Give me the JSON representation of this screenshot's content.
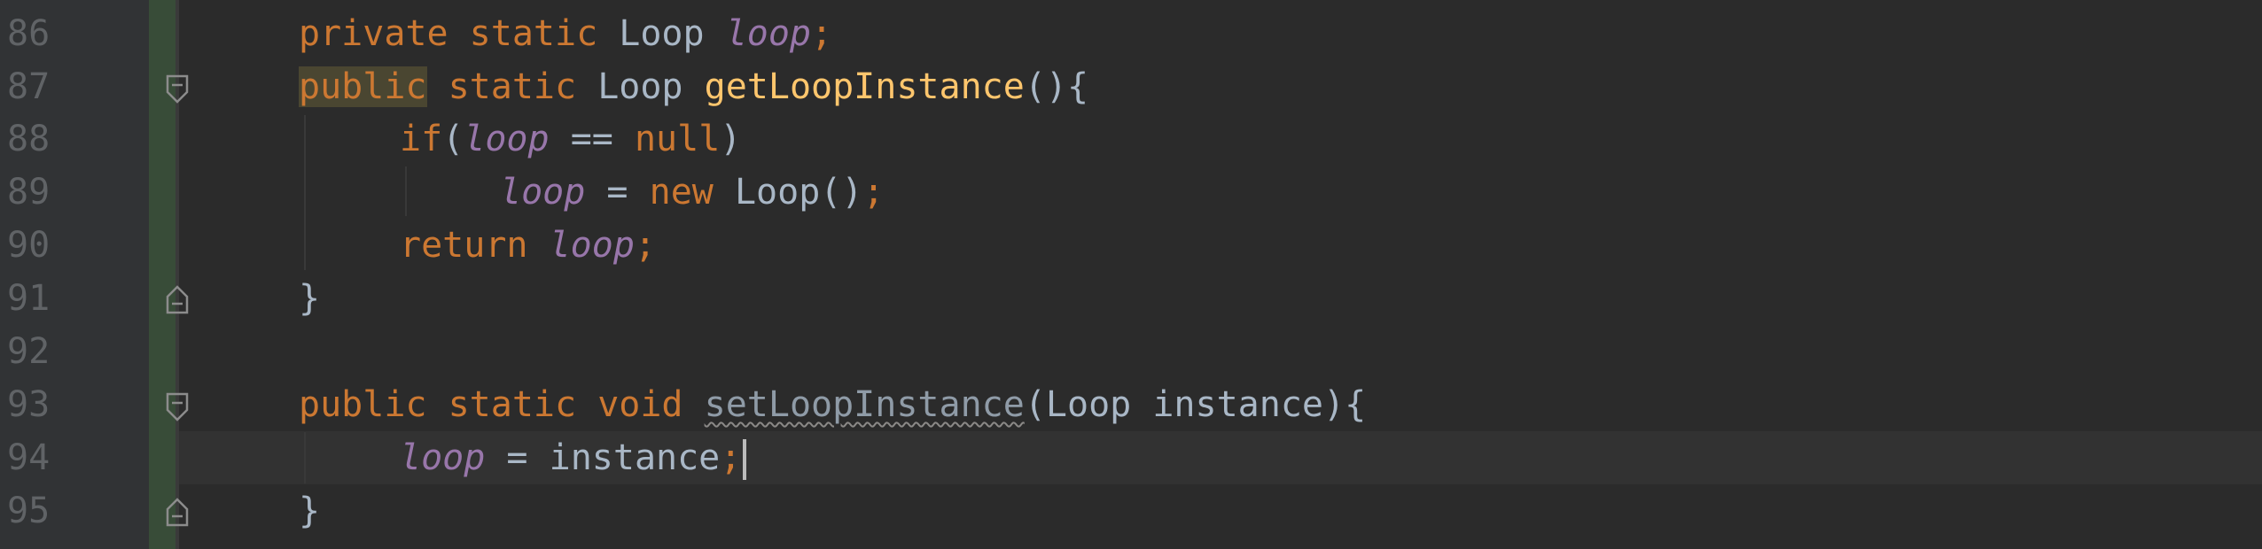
{
  "editor": {
    "line_numbers": [
      "86",
      "87",
      "88",
      "89",
      "90",
      "91",
      "92",
      "93",
      "94",
      "95"
    ],
    "lines": {
      "l86": {
        "kw1": "private",
        "kw2": "static",
        "type": "Loop",
        "field": "loop",
        "semi": ";"
      },
      "l87": {
        "kw1": "public",
        "kw2": "static",
        "type": "Loop",
        "method": "getLoopInstance",
        "tail": "(){"
      },
      "l88": {
        "kw": "if",
        "open": "(",
        "field": "loop",
        "op": "==",
        "null": "null",
        "close": ")"
      },
      "l89": {
        "field": "loop",
        "op": "=",
        "kw": "new",
        "call": "Loop()",
        "semi": ";"
      },
      "l90": {
        "kw": "return",
        "field": "loop",
        "semi": ";"
      },
      "l91": {
        "brace": "}"
      },
      "l93": {
        "kw1": "public",
        "kw2": "static",
        "kw3": "void",
        "method": "setLoopInstance",
        "params": "(Loop instance){"
      },
      "l94": {
        "field": "loop",
        "op": "=",
        "value": "instance",
        "semi": ";"
      },
      "l95": {
        "brace": "}"
      }
    },
    "colors": {
      "background": "#2b2b2b",
      "gutter": "#313335",
      "keyword": "#cc7832",
      "field": "#9876aa",
      "method": "#ffc66d",
      "identifier": "#a9b7c6",
      "line_number": "#606366",
      "changed_marker": "#384c38"
    },
    "icons": {
      "fold_open": "fold-open-icon",
      "fold_close": "fold-close-icon"
    }
  }
}
